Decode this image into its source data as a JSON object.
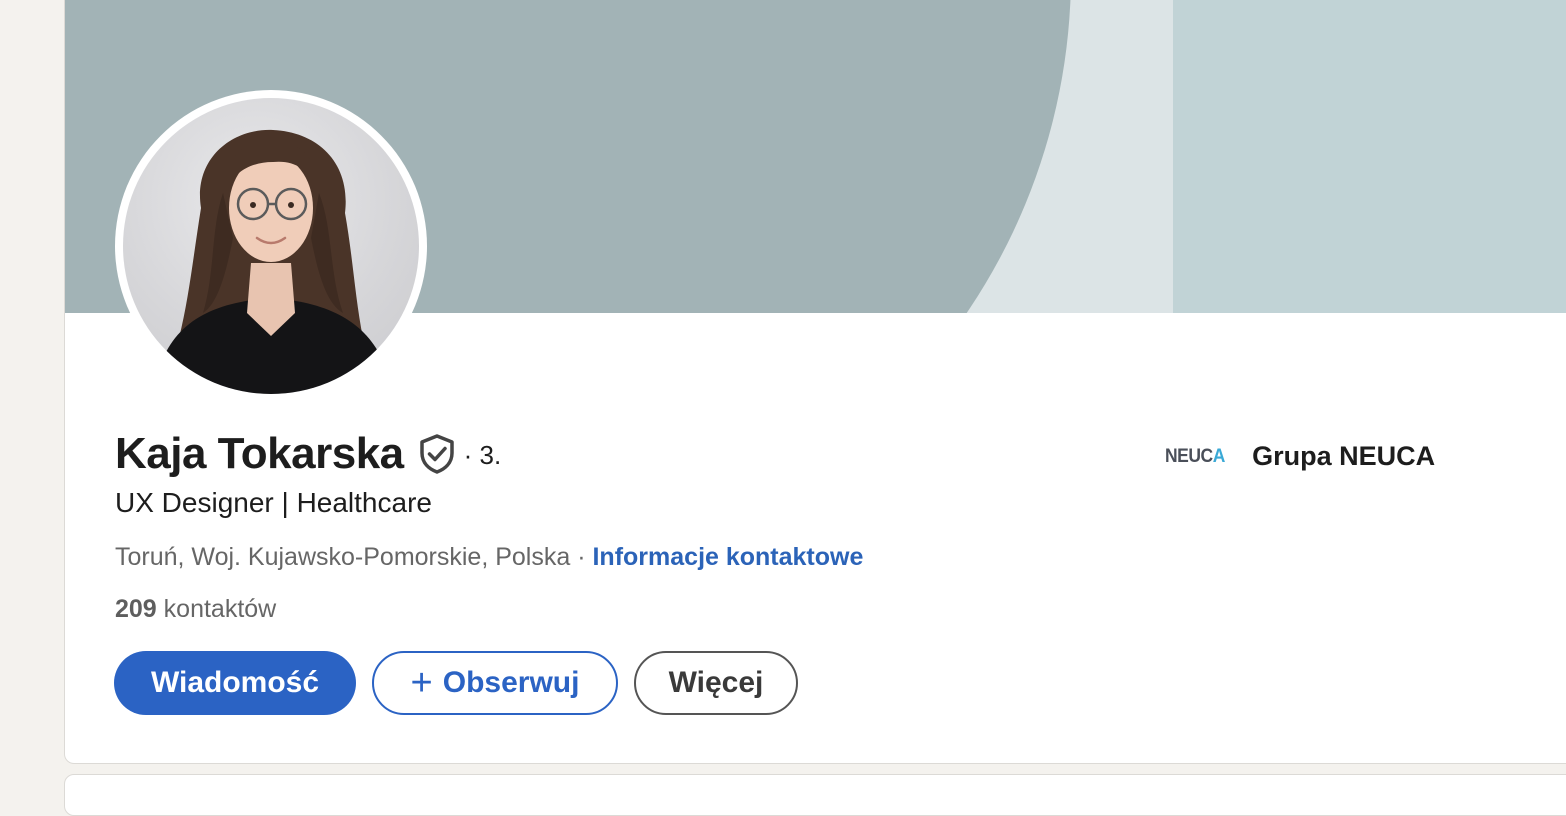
{
  "profile": {
    "name": "Kaja Tokarska",
    "degree": "· 3.",
    "headline": "UX Designer | Healthcare",
    "location": "Toruń, Woj. Kujawsko-Pomorskie, Polska",
    "separator": " · ",
    "contact_info_label": "Informacje kontaktowe",
    "connections_count": "209",
    "connections_label": " kontaktów"
  },
  "actions": {
    "message_label": "Wiadomość",
    "follow_plus": "+",
    "follow_label": "Obserwuj",
    "more_label": "Więcej"
  },
  "company": {
    "logo_text": "NEUC",
    "logo_accent": "A",
    "name": "Grupa NEUCA"
  },
  "icons": {
    "verified": "shield-check-icon",
    "plus": "plus-icon"
  },
  "colors": {
    "primary": "#2b63c4",
    "link": "#2b63b8",
    "banner_dark": "#a2b3b6",
    "banner_light": "#dce4e6",
    "banner_panel": "#c1d3d6"
  }
}
